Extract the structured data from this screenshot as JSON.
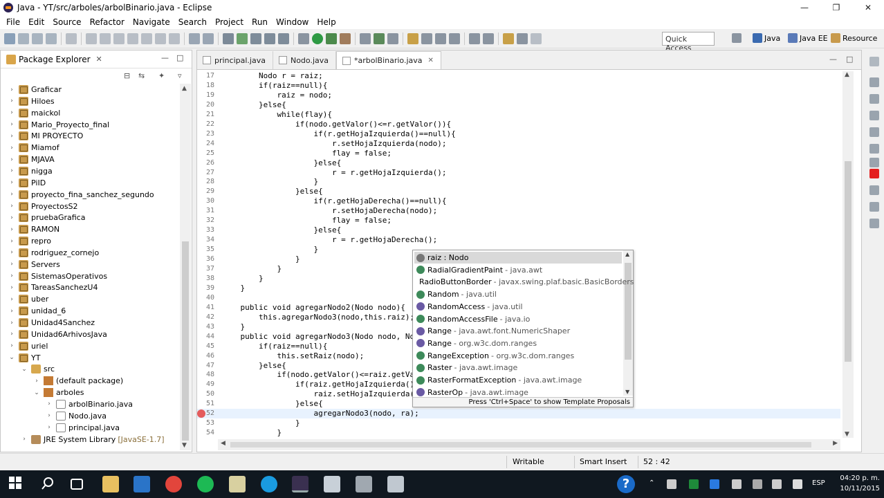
{
  "window": {
    "title": "Java - YT/src/arboles/arbolBinario.java - Eclipse",
    "min": "—",
    "max": "❐",
    "close": "✕"
  },
  "menu": [
    "File",
    "Edit",
    "Source",
    "Refactor",
    "Navigate",
    "Search",
    "Project",
    "Run",
    "Window",
    "Help"
  ],
  "toolbar": {
    "quick_access": "Quick Access",
    "perspectives": [
      "Java",
      "Java EE",
      "Resource"
    ]
  },
  "package_explorer": {
    "title": "Package Explorer",
    "close": "✕",
    "items": [
      {
        "label": "Graficar",
        "level": 0,
        "type": "proj",
        "twisty": "›"
      },
      {
        "label": "Hiloes",
        "level": 0,
        "type": "proj",
        "twisty": "›"
      },
      {
        "label": "maickol",
        "level": 0,
        "type": "proj",
        "twisty": "›"
      },
      {
        "label": "Mario_Proyecto_final",
        "level": 0,
        "type": "proj",
        "twisty": "›"
      },
      {
        "label": "MI PROYECTO",
        "level": 0,
        "type": "proj",
        "twisty": "›"
      },
      {
        "label": "Miamof",
        "level": 0,
        "type": "proj",
        "twisty": "›"
      },
      {
        "label": "MJAVA",
        "level": 0,
        "type": "proj",
        "twisty": "›"
      },
      {
        "label": "nigga",
        "level": 0,
        "type": "proj",
        "twisty": "›"
      },
      {
        "label": "PiID",
        "level": 0,
        "type": "proj",
        "twisty": "›"
      },
      {
        "label": "proyecto_fina_sanchez_segundo",
        "level": 0,
        "type": "proj",
        "twisty": "›"
      },
      {
        "label": "ProyectosS2",
        "level": 0,
        "type": "proj",
        "twisty": "›"
      },
      {
        "label": "pruebaGrafica",
        "level": 0,
        "type": "proj",
        "twisty": "›"
      },
      {
        "label": "RAMON",
        "level": 0,
        "type": "proj",
        "twisty": "›"
      },
      {
        "label": "repro",
        "level": 0,
        "type": "proj",
        "twisty": "›"
      },
      {
        "label": "rodriguez_cornejo",
        "level": 0,
        "type": "proj",
        "twisty": "›"
      },
      {
        "label": "Servers",
        "level": 0,
        "type": "proj",
        "twisty": "›"
      },
      {
        "label": "SistemasOperativos",
        "level": 0,
        "type": "proj",
        "twisty": "›"
      },
      {
        "label": "TareasSanchezU4",
        "level": 0,
        "type": "proj",
        "twisty": "›"
      },
      {
        "label": "uber",
        "level": 0,
        "type": "proj",
        "twisty": "›"
      },
      {
        "label": "unidad_6",
        "level": 0,
        "type": "proj",
        "twisty": "›"
      },
      {
        "label": "Unidad4Sanchez",
        "level": 0,
        "type": "proj",
        "twisty": "›"
      },
      {
        "label": "Unidad6ArhivosJava",
        "level": 0,
        "type": "proj",
        "twisty": "›"
      },
      {
        "label": "uriel",
        "level": 0,
        "type": "proj",
        "twisty": "›"
      },
      {
        "label": "YT",
        "level": 0,
        "type": "proj",
        "twisty": "⌄"
      },
      {
        "label": "src",
        "level": 1,
        "type": "src",
        "twisty": "⌄"
      },
      {
        "label": "(default package)",
        "level": 2,
        "type": "pkg",
        "twisty": "›"
      },
      {
        "label": "arboles",
        "level": 2,
        "type": "pkg",
        "twisty": "⌄"
      },
      {
        "label": "arbolBinario.java",
        "level": 3,
        "type": "java",
        "twisty": "›"
      },
      {
        "label": "Nodo.java",
        "level": 3,
        "type": "java",
        "twisty": "›"
      },
      {
        "label": "principal.java",
        "level": 3,
        "type": "java",
        "twisty": "›"
      },
      {
        "label": "JRE System Library",
        "sub": "[JavaSE-1.7]",
        "level": 1,
        "type": "lib",
        "twisty": "›"
      }
    ]
  },
  "editor": {
    "tabs": [
      {
        "label": "principal.java"
      },
      {
        "label": "Nodo.java"
      },
      {
        "label": "*arbolBinario.java",
        "close": "✕"
      }
    ],
    "lines": [
      {
        "n": "17",
        "code": "        Nodo r = raiz;"
      },
      {
        "n": "18",
        "code": "        if(raiz==null){"
      },
      {
        "n": "19",
        "code": "            raiz = nodo;"
      },
      {
        "n": "20",
        "code": "        }else{"
      },
      {
        "n": "21",
        "code": "            while(flay){"
      },
      {
        "n": "22",
        "code": "                if(nodo.getValor()<=r.getValor()){"
      },
      {
        "n": "23",
        "code": "                    if(r.getHojaIzquierda()==null){"
      },
      {
        "n": "24",
        "code": "                        r.setHojaIzquierda(nodo);"
      },
      {
        "n": "25",
        "code": "                        flay = false;"
      },
      {
        "n": "26",
        "code": "                    }else{"
      },
      {
        "n": "27",
        "code": "                        r = r.getHojaIzquierda();"
      },
      {
        "n": "28",
        "code": "                    }"
      },
      {
        "n": "29",
        "code": "                }else{"
      },
      {
        "n": "30",
        "code": "                    if(r.getHojaDerecha()==null){"
      },
      {
        "n": "31",
        "code": "                        r.setHojaDerecha(nodo);"
      },
      {
        "n": "32",
        "code": "                        flay = false;"
      },
      {
        "n": "33",
        "code": "                    }else{"
      },
      {
        "n": "34",
        "code": "                        r = r.getHojaDerecha();"
      },
      {
        "n": "35",
        "code": "                    }"
      },
      {
        "n": "36",
        "code": "                }"
      },
      {
        "n": "37",
        "code": "            }"
      },
      {
        "n": "38",
        "code": "        }"
      },
      {
        "n": "39",
        "code": "    }"
      },
      {
        "n": "40",
        "code": ""
      },
      {
        "n": "41",
        "code": "    public void agregarNodo2(Nodo nodo){"
      },
      {
        "n": "42",
        "code": "        this.agregarNodo3(nodo,this.raiz);"
      },
      {
        "n": "43",
        "code": "    }"
      },
      {
        "n": "44",
        "code": "    public void agregarNodo3(Nodo nodo, No"
      },
      {
        "n": "45",
        "code": "        if(raiz==null){"
      },
      {
        "n": "46",
        "code": "            this.setRaiz(nodo);"
      },
      {
        "n": "47",
        "code": "        }else{"
      },
      {
        "n": "48",
        "code": "            if(nodo.getValor()<=raiz.getVa"
      },
      {
        "n": "49",
        "code": "                if(raiz.getHojaIzquierda()"
      },
      {
        "n": "50",
        "code": "                    raiz.setHojaIzquierda("
      },
      {
        "n": "51",
        "code": "                }else{"
      },
      {
        "n": "52",
        "code": "                    agregarNodo3(nodo, ra);"
      },
      {
        "n": "53",
        "code": "                }"
      },
      {
        "n": "54",
        "code": "            }"
      }
    ]
  },
  "content_assist": {
    "items": [
      {
        "icon": "f",
        "name": "raiz : Nodo",
        "pkg": ""
      },
      {
        "icon": "c",
        "name": "RadialGradientPaint",
        "pkg": "- java.awt"
      },
      {
        "icon": "c",
        "name": "RadioButtonBorder",
        "pkg": "- javax.swing.plaf.basic.BasicBorders"
      },
      {
        "icon": "c",
        "name": "Random",
        "pkg": "- java.util"
      },
      {
        "icon": "i",
        "name": "RandomAccess",
        "pkg": "- java.util"
      },
      {
        "icon": "c",
        "name": "RandomAccessFile",
        "pkg": "- java.io"
      },
      {
        "icon": "i",
        "name": "Range",
        "pkg": "- java.awt.font.NumericShaper"
      },
      {
        "icon": "i",
        "name": "Range",
        "pkg": "- org.w3c.dom.ranges"
      },
      {
        "icon": "c",
        "name": "RangeException",
        "pkg": "- org.w3c.dom.ranges"
      },
      {
        "icon": "c",
        "name": "Raster",
        "pkg": "- java.awt.image"
      },
      {
        "icon": "c",
        "name": "RasterFormatException",
        "pkg": "- java.awt.image"
      },
      {
        "icon": "i",
        "name": "RasterOp",
        "pkg": "- java.awt.image"
      }
    ],
    "footer": "Press 'Ctrl+Space' to show Template Proposals"
  },
  "status_bar": {
    "writable": "Writable",
    "insert_mode": "Smart Insert",
    "position": "52 : 42"
  },
  "taskbar": {
    "lang": "ESP",
    "time": "04:20 p. m.",
    "date": "10/11/2015"
  },
  "colors": {
    "keyword": "#7f0055",
    "field": "#0000c0",
    "taskbar": "#101820",
    "error_marker": "#e45c5c"
  }
}
